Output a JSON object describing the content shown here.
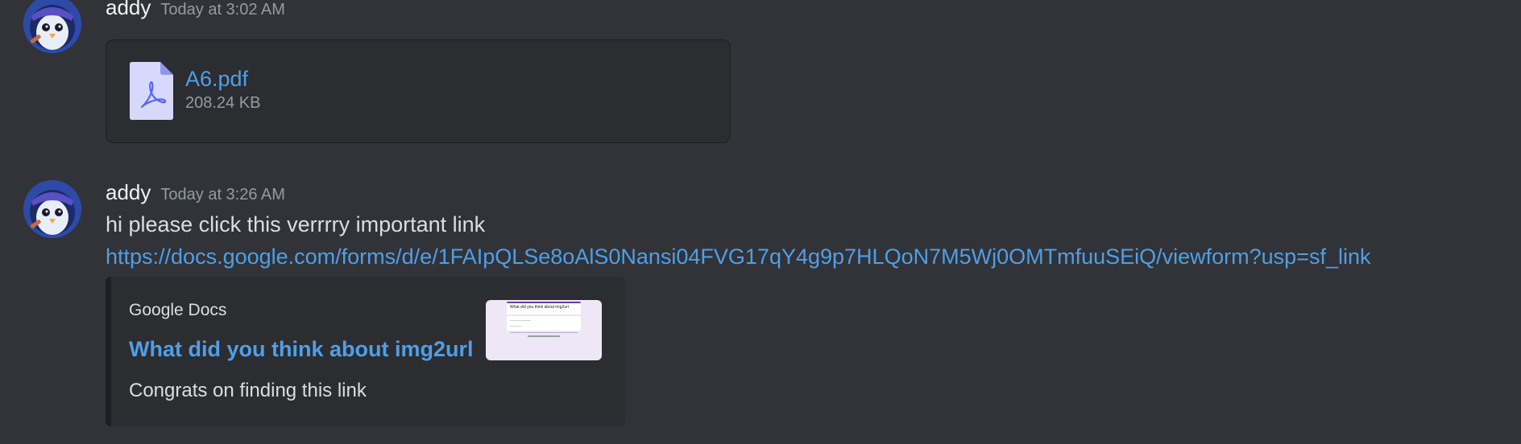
{
  "messages": [
    {
      "author": "addy",
      "timestamp": "Today at 3:02 AM",
      "attachment": {
        "file_name": "A6.pdf",
        "file_size": "208.24 KB",
        "icon": "pdf-file-icon"
      }
    },
    {
      "author": "addy",
      "timestamp": "Today at 3:26 AM",
      "text": "hi please click this verrrry important link",
      "link": "https://docs.google.com/forms/d/e/1FAIpQLSe8oAlS0Nansi04FVG17qY4g9p7HLQoN7M5Wj0OMTmfuuSEiQ/viewform?usp=sf_link",
      "embed": {
        "provider": "Google Docs",
        "title": "What did you think about img2url",
        "description": "Congrats on finding this link",
        "thumbnail": {
          "form_title": "What did you think about img2url"
        }
      }
    }
  ],
  "colors": {
    "background": "#313338",
    "embed_background": "#2b2d31",
    "link": "#4f9fe8",
    "username": "#f2f3f5",
    "timestamp": "#949ba4",
    "text": "#dbdee1"
  }
}
